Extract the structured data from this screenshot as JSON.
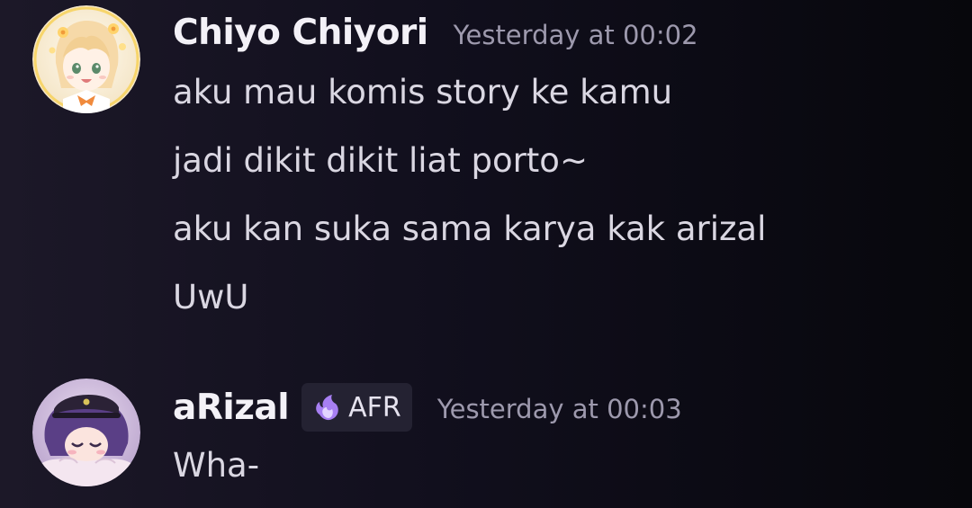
{
  "messages": [
    {
      "author": "Chiyo Chiyori",
      "avatar_icon": "anime-girl-avatar",
      "timestamp": "Yesterday at 00:02",
      "lines": [
        "aku mau komis story ke kamu",
        "jadi dikit dikit liat porto~",
        "aku kan suka sama karya kak arizal",
        "UwU"
      ]
    },
    {
      "author": "aRizal",
      "avatar_icon": "anime-boy-avatar",
      "tag": {
        "icon": "purple-flame-icon",
        "label": "AFR"
      },
      "timestamp": "Yesterday at 00:03",
      "lines": [
        "Wha-"
      ]
    }
  ],
  "colors": {
    "background": "#110f1d",
    "username": "#f3f1f7",
    "timestamp": "#9d99ad",
    "message_text": "#dad7e2",
    "tag_background": "#242232"
  }
}
